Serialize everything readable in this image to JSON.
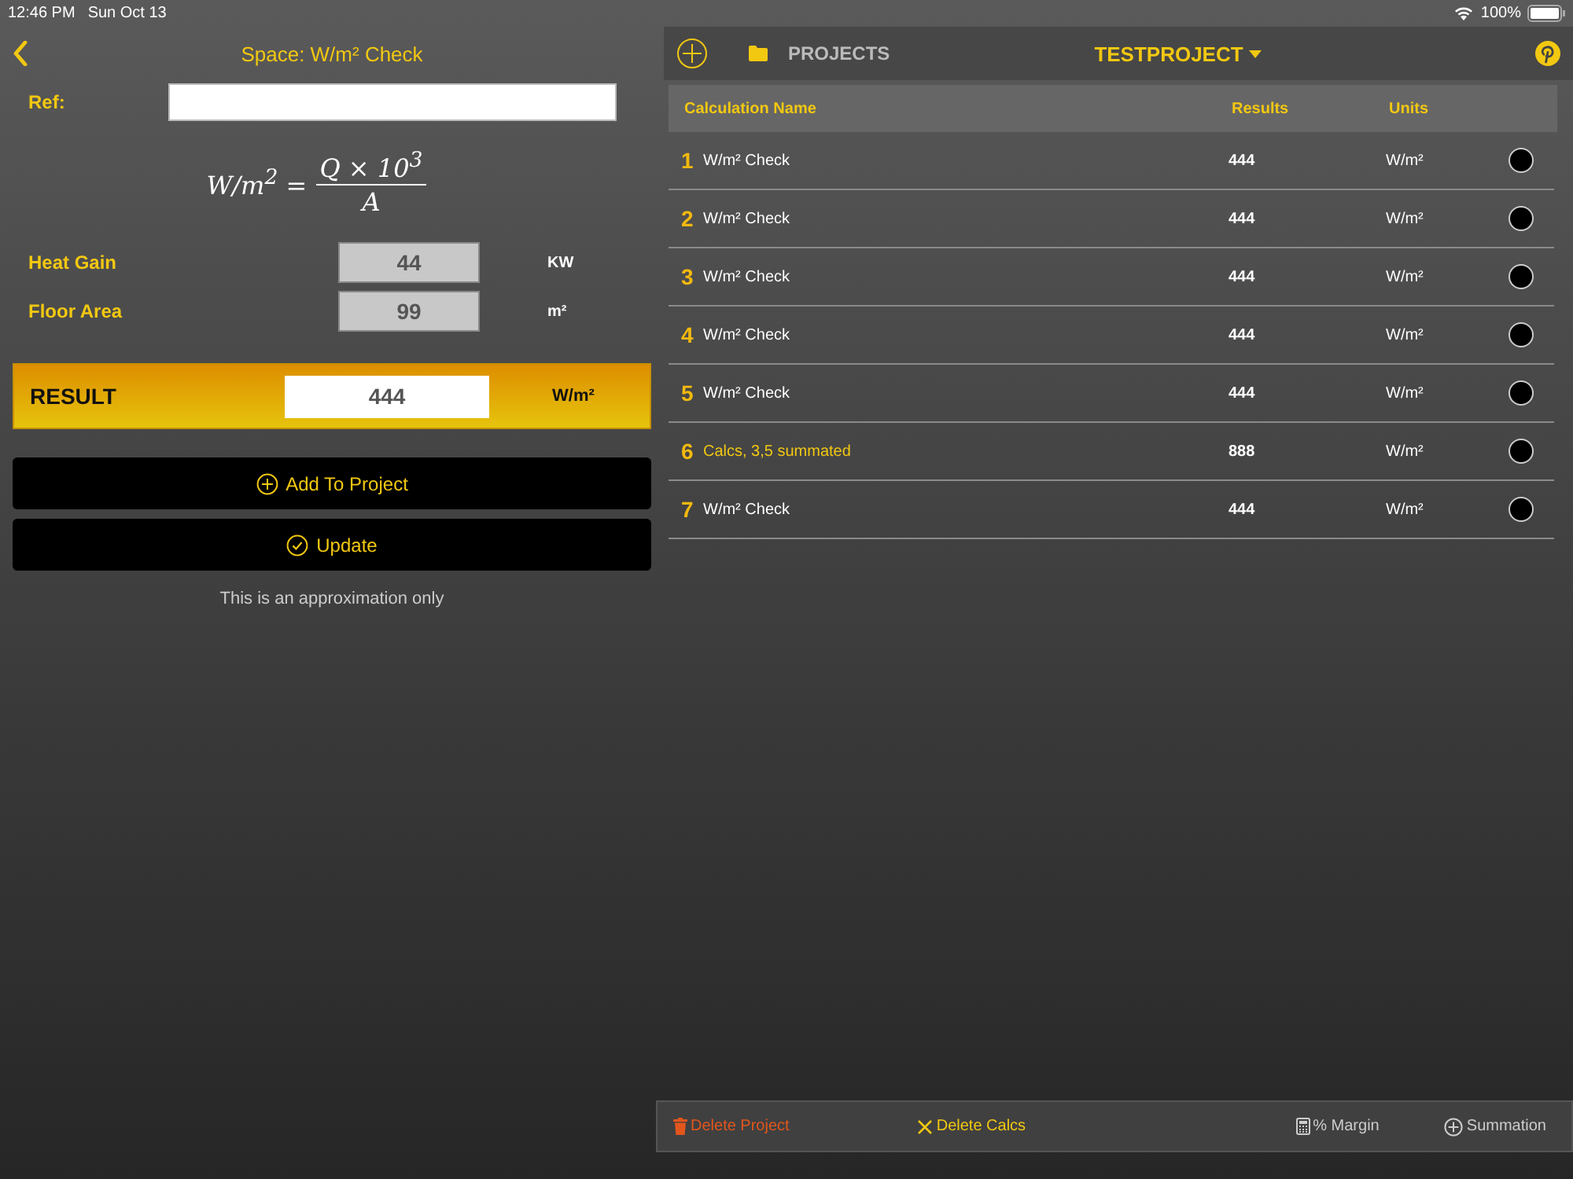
{
  "status_bar": {
    "time": "12:46 PM",
    "date": "Sun Oct 13",
    "battery": "100%"
  },
  "calculator": {
    "title": "Space: W/m² Check",
    "ref": {
      "label": "Ref:"
    },
    "formula": {
      "lhs": "W/m$^{2}$ =",
      "numerator": "Q × 10$^{3}$",
      "denominator": "A"
    },
    "inputs": [
      {
        "label": "Heat Gain",
        "value": "44",
        "unit": "KW"
      },
      {
        "label": "Floor Area",
        "value": "99",
        "unit": "m²"
      }
    ],
    "result": {
      "label": "RESULT",
      "value": "444",
      "unit": "W/m²"
    },
    "buttons": [
      {
        "kind": "add",
        "label": "Add To Project"
      },
      {
        "kind": "update",
        "label": "Update"
      }
    ],
    "note": "This is an approximation only"
  },
  "projects": {
    "label": "PROJECTS",
    "current": "TESTPROJECT",
    "columns": [
      "Calculation Name",
      "Results",
      "Units"
    ],
    "rows": [
      {
        "number": "1",
        "name": "W/m² Check",
        "result": "444",
        "unit": "W/m²",
        "kind": "calc",
        "selected": false
      },
      {
        "number": "2",
        "name": "W/m² Check",
        "result": "444",
        "unit": "W/m²",
        "kind": "calc",
        "selected": false
      },
      {
        "number": "3",
        "name": "W/m² Check",
        "result": "444",
        "unit": "W/m²",
        "kind": "calc",
        "selected": false
      },
      {
        "number": "4",
        "name": "W/m² Check",
        "result": "444",
        "unit": "W/m²",
        "kind": "calc",
        "selected": false
      },
      {
        "number": "5",
        "name": "W/m² Check",
        "result": "444",
        "unit": "W/m²",
        "kind": "calc",
        "selected": false
      },
      {
        "number": "6",
        "name": "Calcs, 3,5 summated",
        "result": "888",
        "unit": "W/m²",
        "kind": "summation",
        "selected": false
      },
      {
        "number": "7",
        "name": "W/m² Check",
        "result": "444",
        "unit": "W/m²",
        "kind": "calc",
        "selected": false
      }
    ],
    "toolbar": [
      {
        "kind": "delete-project",
        "label": "Delete Project"
      },
      {
        "kind": "delete-calcs",
        "label": "Delete Calcs"
      },
      {
        "kind": "margin",
        "label": "% Margin"
      },
      {
        "kind": "summation",
        "label": "Summation"
      }
    ]
  }
}
